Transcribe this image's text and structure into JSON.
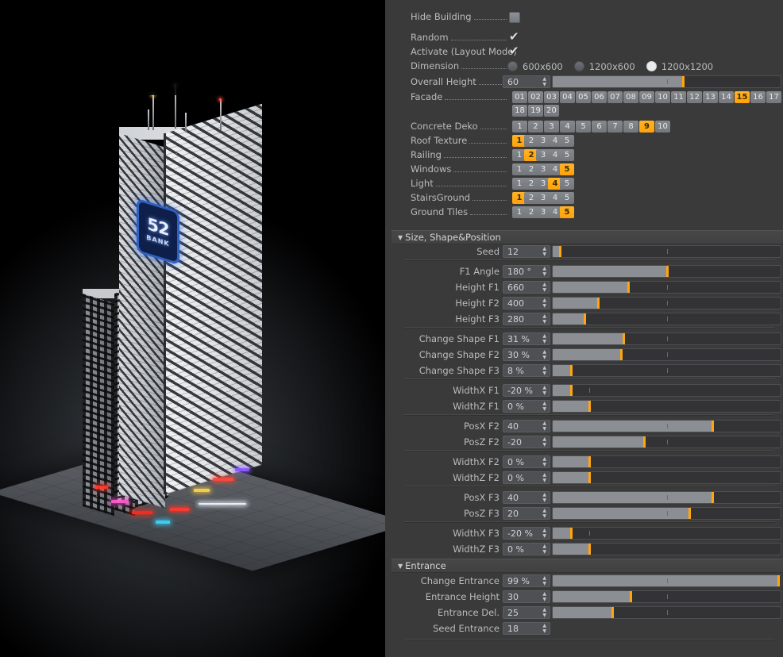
{
  "app": {
    "viewport_label": "3d-render-viewport",
    "logo_number": "52",
    "logo_word": "BANK"
  },
  "colors": {
    "accent": "#ffa510",
    "panel_bg": "#3a3a3a",
    "label": "#b9bbbd",
    "field_bg": "#4e5053",
    "slider_bg": "#333335",
    "slider_fill": "#8b8e92",
    "button": "#7a7d81",
    "logo_blue": "#2f5fc0"
  },
  "general": {
    "hide_building": {
      "label": "Hide Building",
      "checked": false
    },
    "random": {
      "label": "Random",
      "checked": true
    },
    "activate": {
      "label": "Activate (Layout Mode)",
      "checked": true
    },
    "dimension": {
      "label": "Dimension",
      "options": [
        "600x600",
        "1200x600",
        "1200x1200"
      ],
      "selected": "1200x1200"
    },
    "overall_height": {
      "label": "Overall Height",
      "value": "60",
      "fill_pct": 57,
      "handle_pct": 57,
      "tick_pct": 50
    },
    "facade": {
      "label": "Facade",
      "options": [
        "01",
        "02",
        "03",
        "04",
        "05",
        "06",
        "07",
        "08",
        "09",
        "10",
        "11",
        "12",
        "13",
        "14",
        "15",
        "16",
        "17",
        "18",
        "19",
        "20"
      ],
      "selected": "15"
    },
    "concrete_deko": {
      "label": "Concrete Deko",
      "options": [
        "1",
        "2",
        "3",
        "4",
        "5",
        "6",
        "7",
        "8",
        "9",
        "10"
      ],
      "selected": "9"
    },
    "roof_texture": {
      "label": "Roof Texture",
      "options": [
        "1",
        "2",
        "3",
        "4",
        "5"
      ],
      "selected": "1"
    },
    "railing": {
      "label": "Railing",
      "options": [
        "1",
        "2",
        "3",
        "4",
        "5"
      ],
      "selected": "2"
    },
    "windows": {
      "label": "Windows",
      "options": [
        "1",
        "2",
        "3",
        "4",
        "5"
      ],
      "selected": "5"
    },
    "light": {
      "label": "Light",
      "options": [
        "1",
        "2",
        "3",
        "4",
        "5"
      ],
      "selected": "4"
    },
    "stairs_ground": {
      "label": "StairsGround",
      "options": [
        "1",
        "2",
        "3",
        "4",
        "5"
      ],
      "selected": "1"
    },
    "ground_tiles": {
      "label": "Ground Tiles",
      "options": [
        "1",
        "2",
        "3",
        "4",
        "5"
      ],
      "selected": "5"
    }
  },
  "size_section": {
    "title": "Size, Shape&Position",
    "rows": [
      {
        "label": "Seed",
        "value": "12",
        "fill_pct": 3,
        "handle_pct": 3,
        "tick_pct": 50
      },
      {
        "label": "F1 Angle",
        "value": "180 °",
        "fill_pct": 50,
        "handle_pct": 50,
        "tick_pct": 50
      },
      {
        "label": "Height F1",
        "value": "660",
        "fill_pct": 33,
        "handle_pct": 33,
        "tick_pct": 50
      },
      {
        "label": "Height F2",
        "value": "400",
        "fill_pct": 20,
        "handle_pct": 20,
        "tick_pct": 50
      },
      {
        "label": "Height F3",
        "value": "280",
        "fill_pct": 14,
        "handle_pct": 14,
        "tick_pct": 50
      },
      {
        "label": "Change Shape F1",
        "value": "31 %",
        "fill_pct": 31,
        "handle_pct": 31,
        "tick_pct": 50
      },
      {
        "label": "Change Shape F2",
        "value": "30 %",
        "fill_pct": 30,
        "handle_pct": 30,
        "tick_pct": 50
      },
      {
        "label": "Change Shape F3",
        "value": "8 %",
        "fill_pct": 8,
        "handle_pct": 8,
        "tick_pct": 50
      },
      {
        "label": "WidthX F1",
        "value": "-20 %",
        "fill_pct": 8,
        "handle_pct": 8,
        "tick_pct": 16
      },
      {
        "label": "WidthZ F1",
        "value": "0 %",
        "fill_pct": 16,
        "handle_pct": 16,
        "tick_pct": 16
      },
      {
        "label": "PosX F2",
        "value": "40",
        "fill_pct": 70,
        "handle_pct": 70,
        "tick_pct": 50
      },
      {
        "label": "PosZ F2",
        "value": "-20",
        "fill_pct": 40,
        "handle_pct": 40,
        "tick_pct": 50
      },
      {
        "label": "WidthX F2",
        "value": "0 %",
        "fill_pct": 16,
        "handle_pct": 16,
        "tick_pct": 16
      },
      {
        "label": "WidthZ F2",
        "value": "0 %",
        "fill_pct": 16,
        "handle_pct": 16,
        "tick_pct": 16
      },
      {
        "label": "PosX F3",
        "value": "40",
        "fill_pct": 70,
        "handle_pct": 70,
        "tick_pct": 50
      },
      {
        "label": "PosZ F3",
        "value": "20",
        "fill_pct": 60,
        "handle_pct": 60,
        "tick_pct": 50
      },
      {
        "label": "WidthX F3",
        "value": "-20 %",
        "fill_pct": 8,
        "handle_pct": 8,
        "tick_pct": 16
      },
      {
        "label": "WidthZ F3",
        "value": "0 %",
        "fill_pct": 16,
        "handle_pct": 16,
        "tick_pct": 16
      }
    ]
  },
  "entrance_section": {
    "title": "Entrance",
    "rows": [
      {
        "label": "Change Entrance",
        "value": "99 %",
        "fill_pct": 99,
        "handle_pct": 99,
        "tick_pct": 50
      },
      {
        "label": "Entrance Height",
        "value": "30",
        "fill_pct": 34,
        "handle_pct": 34,
        "tick_pct": 50
      },
      {
        "label": "Entrance Del.",
        "value": "25",
        "fill_pct": 26,
        "handle_pct": 26,
        "tick_pct": 50
      },
      {
        "label": "Seed Entrance",
        "value": "18",
        "no_slider": true
      }
    ]
  }
}
